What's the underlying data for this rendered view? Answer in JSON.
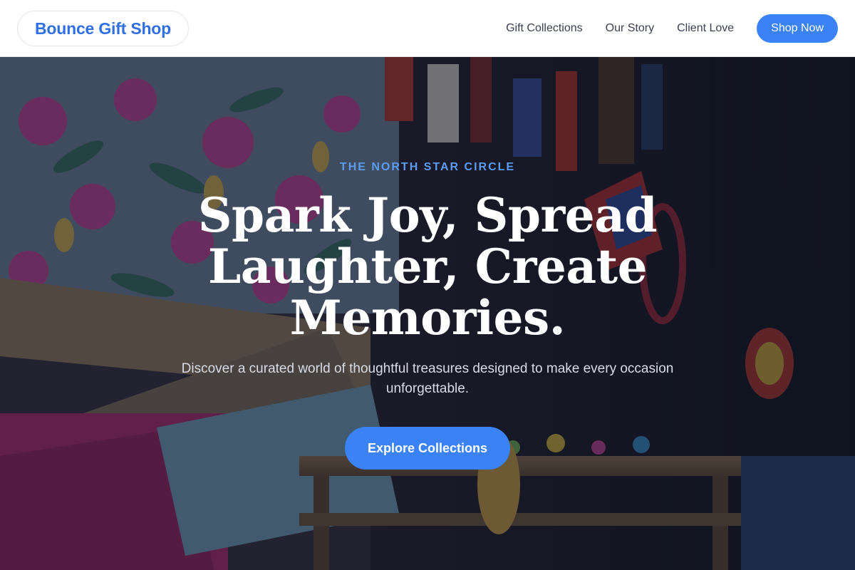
{
  "header": {
    "logo_text": "Bounce Gift Shop",
    "nav_items": [
      "Gift Collections",
      "Our Story",
      "Client Love"
    ],
    "cta_label": "Shop Now"
  },
  "hero": {
    "eyebrow": "THE NORTH STAR CIRCLE",
    "headline": "Spark Joy, Spread Laughter, Create Memories.",
    "subtext": "Discover a curated world of thoughtful treasures designed to make every occasion unforgettable.",
    "button_label": "Explore Collections"
  },
  "colors": {
    "accent": "#3b82f6",
    "logo": "#2f6fe0",
    "eyebrow": "#5b9cf5"
  }
}
